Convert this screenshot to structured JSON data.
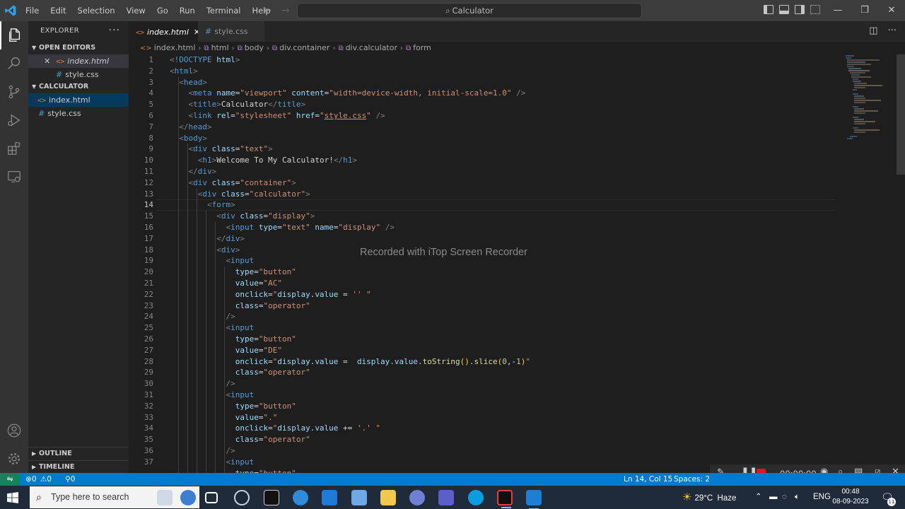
{
  "titlebar": {
    "menu": [
      "File",
      "Edit",
      "Selection",
      "View",
      "Go",
      "Run",
      "Terminal",
      "Help"
    ],
    "search": "Calculator"
  },
  "sidebar": {
    "title": "EXPLORER",
    "open_editors_label": "OPEN EDITORS",
    "open_editors": [
      "index.html",
      "style.css"
    ],
    "folder_label": "CALCULATOR",
    "files": [
      "index.html",
      "style.css"
    ],
    "outline_label": "OUTLINE",
    "timeline_label": "TIMELINE"
  },
  "tabs": [
    {
      "label": "index.html",
      "active": true
    },
    {
      "label": "style.css",
      "active": false
    }
  ],
  "breadcrumbs": [
    "index.html",
    "html",
    "body",
    "div.container",
    "div.calculator",
    "form"
  ],
  "editor": {
    "line_numbers": [
      "1",
      "2",
      "3",
      "4",
      "5",
      "6",
      "7",
      "8",
      "9",
      "10",
      "11",
      "12",
      "13",
      "14",
      "15",
      "16",
      "17",
      "18",
      "19",
      "20",
      "21",
      "22",
      "23",
      "24",
      "25",
      "26",
      "27",
      "28",
      "29",
      "30",
      "31",
      "32",
      "33",
      "34",
      "35",
      "36",
      "37"
    ],
    "current_line": 14,
    "watermark": "Recorded with iTop Screen Recorder"
  },
  "statusbar": {
    "errors": "0",
    "warnings": "0",
    "ports": "0",
    "position": "Ln 14, Col 15",
    "spaces": "Spaces: 2"
  },
  "recorder": {
    "time": "00:00:00"
  },
  "taskbar": {
    "search_placeholder": "Type here to search",
    "weather": "29°C  Haze",
    "language": "ENG",
    "time": "00:48",
    "date": "08-09-2023",
    "notification_count": "11"
  },
  "colors": {
    "statusbar": "#007acc",
    "activitybar": "#333333",
    "sidebar": "#252526",
    "editor": "#1e1e1e",
    "tag": "#569cd6",
    "attribute": "#9cdcfe",
    "string": "#ce9178"
  }
}
